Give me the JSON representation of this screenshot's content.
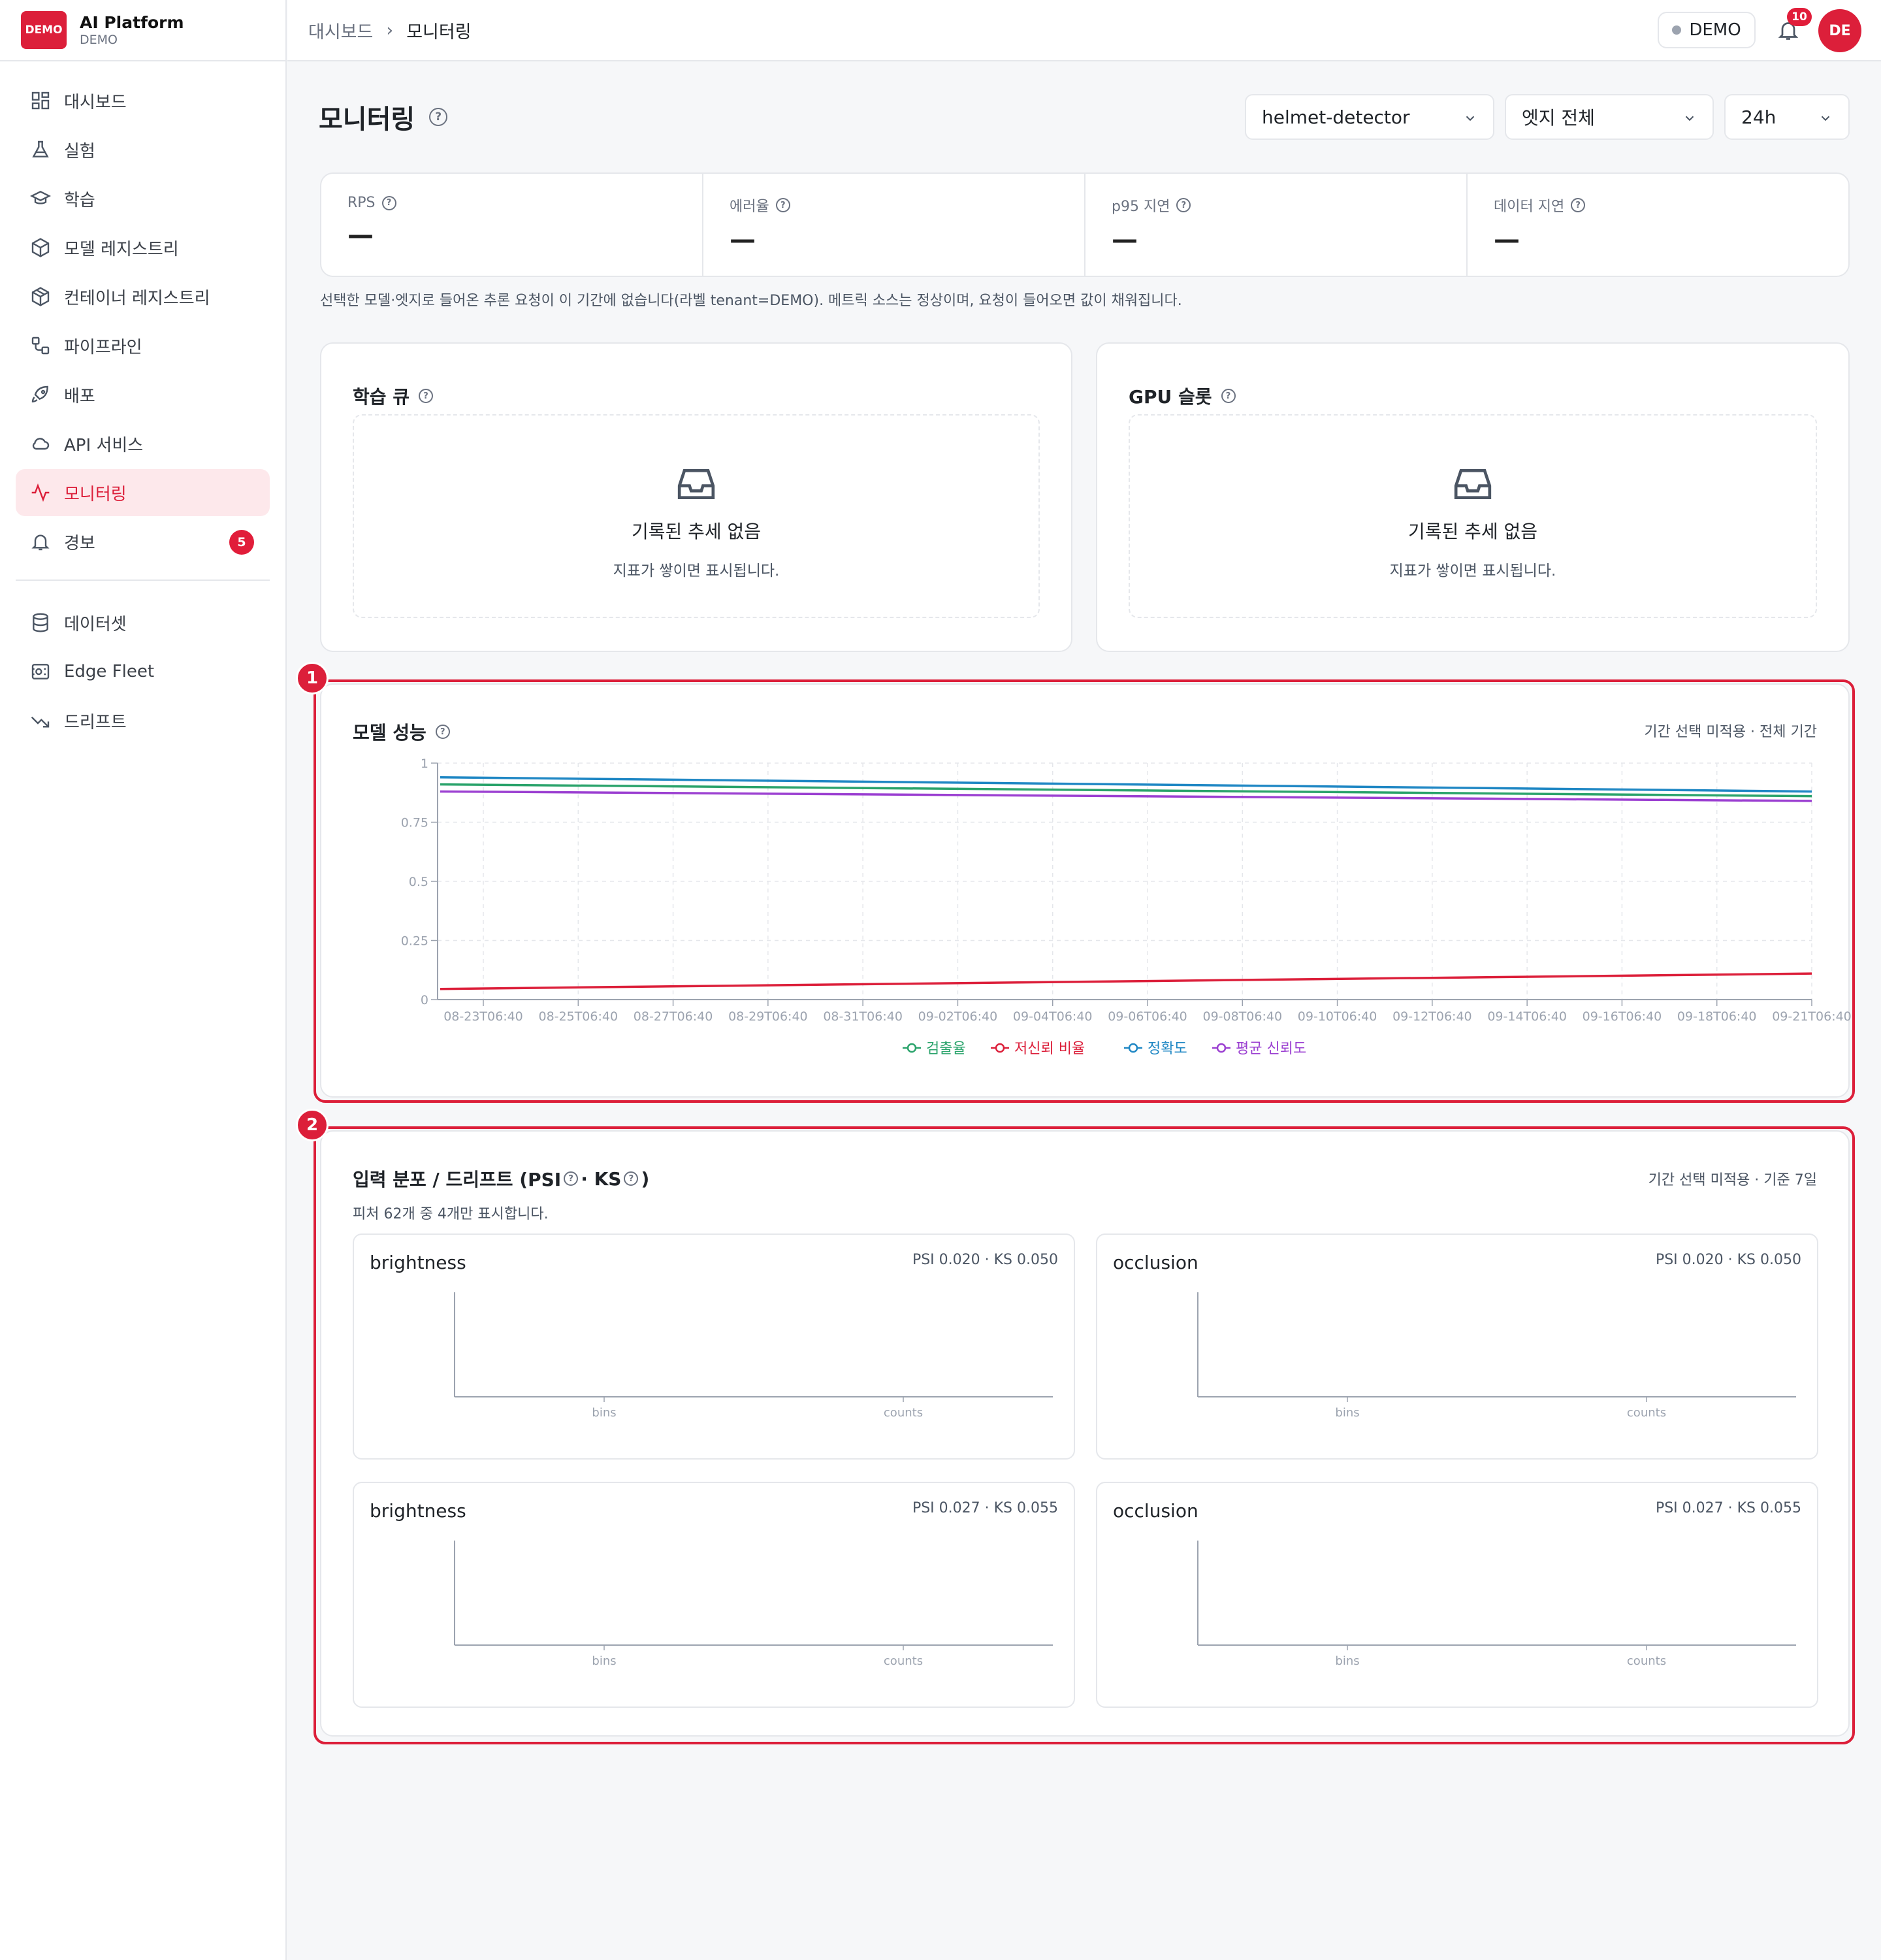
{
  "app": {
    "logo_text": "DEMO",
    "title": "AI Platform",
    "subtitle": "DEMO"
  },
  "sidebar": {
    "items": [
      {
        "label": "대시보드",
        "icon": "dashboard-icon"
      },
      {
        "label": "실험",
        "icon": "flask-icon"
      },
      {
        "label": "학습",
        "icon": "graduation-cap-icon"
      },
      {
        "label": "모델 레지스트리",
        "icon": "cube-icon"
      },
      {
        "label": "컨테이너 레지스트리",
        "icon": "package-icon"
      },
      {
        "label": "파이프라인",
        "icon": "pipeline-icon"
      },
      {
        "label": "배포",
        "icon": "rocket-icon"
      },
      {
        "label": "API 서비스",
        "icon": "cloud-icon"
      },
      {
        "label": "모니터링",
        "icon": "activity-icon",
        "active": true
      },
      {
        "label": "경보",
        "icon": "bell-icon",
        "badge": "5"
      }
    ],
    "items2": [
      {
        "label": "데이터셋",
        "icon": "database-icon"
      },
      {
        "label": "Edge Fleet",
        "icon": "edge-device-icon"
      },
      {
        "label": "드리프트",
        "icon": "trending-down-icon"
      }
    ]
  },
  "topbar": {
    "breadcrumb": [
      "대시보드",
      "모니터링"
    ],
    "tenant": "DEMO",
    "notifications": "10",
    "avatar": "DE"
  },
  "page": {
    "title": "모니터링",
    "filters": {
      "model": "helmet-detector",
      "edge": "엣지 전체",
      "range": "24h"
    }
  },
  "stats": [
    {
      "label": "RPS",
      "value": "—"
    },
    {
      "label": "에러율",
      "value": "—"
    },
    {
      "label": "p95 지연",
      "value": "—"
    },
    {
      "label": "데이터 지연",
      "value": "—"
    }
  ],
  "stats_note": "선택한 모델·엣지로 들어온 추론 요청이 이 기간에 없습니다(라벨 tenant=DEMO). 메트릭 소스는 정상이며, 요청이 들어오면 값이 채워집니다.",
  "queue_card": {
    "title": "학습 큐",
    "empty_title": "기록된 추세 없음",
    "empty_sub": "지표가 쌓이면 표시됩니다."
  },
  "gpu_card": {
    "title": "GPU 슬롯",
    "empty_title": "기록된 추세 없음",
    "empty_sub": "지표가 쌓이면 표시됩니다."
  },
  "markers": [
    "1",
    "2"
  ],
  "performance": {
    "title": "모델 성능",
    "meta": "기간 선택 미적용 · 전체 기간"
  },
  "chart_data": {
    "type": "line",
    "x": [
      "08-23T06:40",
      "08-25T06:40",
      "08-27T06:40",
      "08-29T06:40",
      "08-31T06:40",
      "09-02T06:40",
      "09-04T06:40",
      "09-06T06:40",
      "09-08T06:40",
      "09-10T06:40",
      "09-12T06:40",
      "09-14T06:40",
      "09-16T06:40",
      "09-18T06:40",
      "09-21T06:40"
    ],
    "yticks": [
      "0",
      "0.25",
      "0.5",
      "0.75",
      "1"
    ],
    "ylim": [
      0,
      1
    ],
    "legend_position": "bottom-center",
    "grid": true,
    "series": [
      {
        "name": "검출율",
        "color": "#2aa36b",
        "start": 0.91,
        "end": 0.86
      },
      {
        "name": "저신뢰 비율",
        "color": "#dc1f3a",
        "start": 0.045,
        "end": 0.11
      },
      {
        "name": "정확도",
        "color": "#1f87c4",
        "start": 0.94,
        "end": 0.88
      },
      {
        "name": "평균 신뢰도",
        "color": "#9b3fd1",
        "start": 0.88,
        "end": 0.84
      }
    ]
  },
  "drift": {
    "title_main": "입력 분포 / 드리프트 (PSI",
    "title_mid": "· KS",
    "title_end": ")",
    "meta": "기간 선택 미적용 · 기준 7일",
    "subtitle": "피처 62개 중 4개만 표시합니다.",
    "axis_x": "bins",
    "axis_y": "counts",
    "features": [
      {
        "name": "brightness",
        "stat": "PSI 0.020 · KS 0.050"
      },
      {
        "name": "occlusion",
        "stat": "PSI 0.020 · KS 0.050"
      },
      {
        "name": "brightness",
        "stat": "PSI 0.027 · KS 0.055"
      },
      {
        "name": "occlusion",
        "stat": "PSI 0.027 · KS 0.055"
      }
    ]
  }
}
